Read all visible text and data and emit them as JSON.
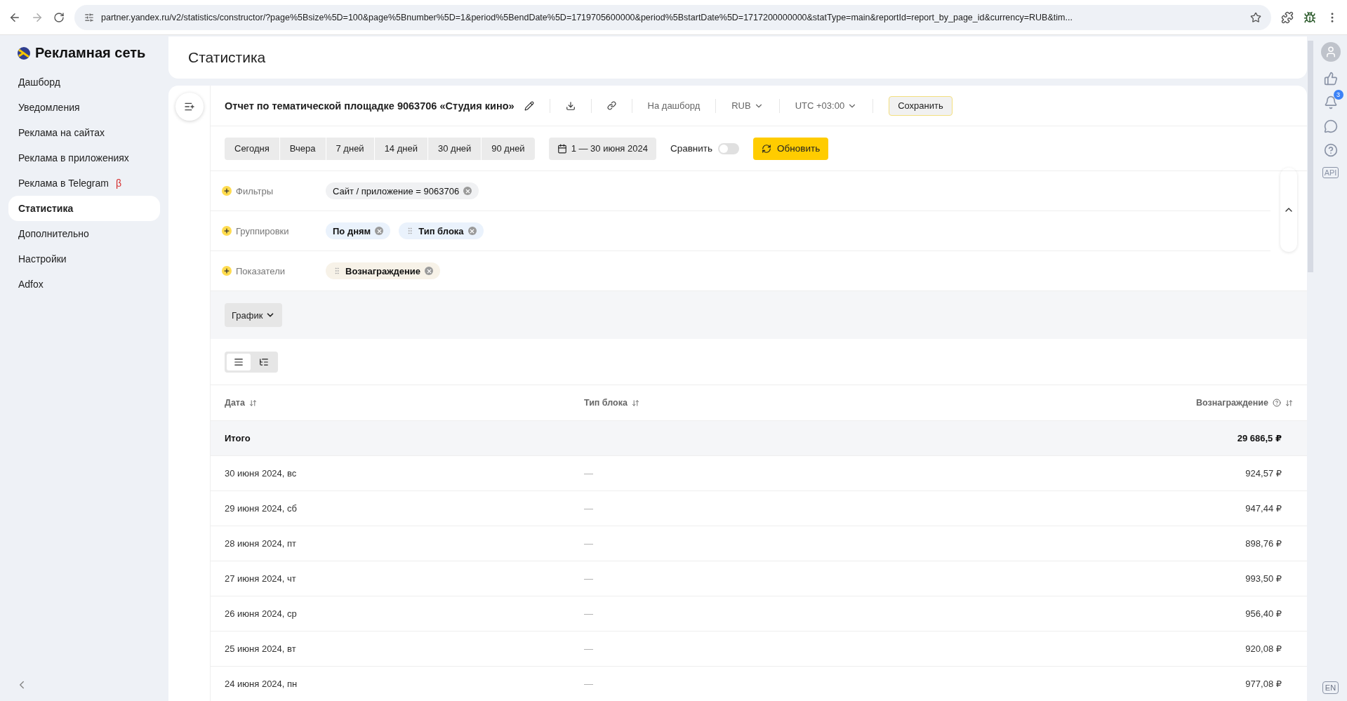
{
  "browser": {
    "url": "partner.yandex.ru/v2/statistics/constructor/?page%5Bsize%5D=100&page%5Bnumber%5D=1&period%5BendDate%5D=1719705600000&period%5BstartDate%5D=1717200000000&statType=main&reportId=report_by_page_id&currency=RUB&tim..."
  },
  "sidebar": {
    "logo": "Рекламная сеть",
    "items": [
      {
        "label": "Дашборд",
        "selected": false
      },
      {
        "label": "Уведомления",
        "selected": false
      },
      {
        "label": "Реклама на сайтах",
        "selected": false
      },
      {
        "label": "Реклама в приложениях",
        "selected": false
      },
      {
        "label": "Реклама в Telegram",
        "selected": false,
        "badge": "β"
      },
      {
        "label": "Статистика",
        "selected": true
      },
      {
        "label": "Дополнительно",
        "selected": false
      },
      {
        "label": "Настройки",
        "selected": false
      },
      {
        "label": "Adfox",
        "selected": false
      }
    ]
  },
  "page_title": "Статистика",
  "report": {
    "title": "Отчет по тематической площадке 9063706 «Студия кино»",
    "dashboard": "На дашборд",
    "currency": "RUB",
    "timezone": "UTC +03:00",
    "save": "Сохранить"
  },
  "periods": [
    {
      "label": "Сегодня",
      "selected": false
    },
    {
      "label": "Вчера",
      "selected": false
    },
    {
      "label": "7 дней",
      "selected": false
    },
    {
      "label": "14 дней",
      "selected": false
    },
    {
      "label": "30 дней",
      "selected": false
    },
    {
      "label": "90 дней",
      "selected": false
    }
  ],
  "date_range": "1 — 30 июня 2024",
  "compare": {
    "label": "Сравнить",
    "on": false
  },
  "refresh": "Обновить",
  "sections": [
    {
      "label": "Фильтры",
      "chips": [
        {
          "text": "Сайт / приложение = 9063706",
          "kind": "filter",
          "draggable": false
        }
      ]
    },
    {
      "label": "Группировки",
      "chips": [
        {
          "text": "По дням",
          "kind": "group",
          "draggable": false
        },
        {
          "text": "Тип блока",
          "kind": "group",
          "draggable": true
        }
      ]
    },
    {
      "label": "Показатели",
      "chips": [
        {
          "text": "Вознаграждение",
          "kind": "metric",
          "draggable": true
        }
      ]
    }
  ],
  "chart_button": "График",
  "view_toggle": [
    {
      "kind": "flat",
      "selected": true
    },
    {
      "kind": "tree",
      "selected": false
    }
  ],
  "table": {
    "columns": [
      {
        "label": "Дата",
        "help": false
      },
      {
        "label": "Тип блока",
        "help": false
      },
      {
        "label": "Вознаграждение",
        "help": true
      }
    ],
    "total": {
      "label": "Итого",
      "value": "29 686,5 ₽"
    },
    "rows": [
      {
        "date": "30 июня 2024, вс",
        "block": "—",
        "reward": "924,57 ₽"
      },
      {
        "date": "29 июня 2024, сб",
        "block": "—",
        "reward": "947,44 ₽"
      },
      {
        "date": "28 июня 2024, пт",
        "block": "—",
        "reward": "898,76 ₽"
      },
      {
        "date": "27 июня 2024, чт",
        "block": "—",
        "reward": "993,50 ₽"
      },
      {
        "date": "26 июня 2024, ср",
        "block": "—",
        "reward": "956,40 ₽"
      },
      {
        "date": "25 июня 2024, вт",
        "block": "—",
        "reward": "920,08 ₽"
      },
      {
        "date": "24 июня 2024, пн",
        "block": "—",
        "reward": "977,08 ₽"
      }
    ]
  },
  "rail": {
    "notifications": "3",
    "api": "API",
    "language": "EN"
  }
}
